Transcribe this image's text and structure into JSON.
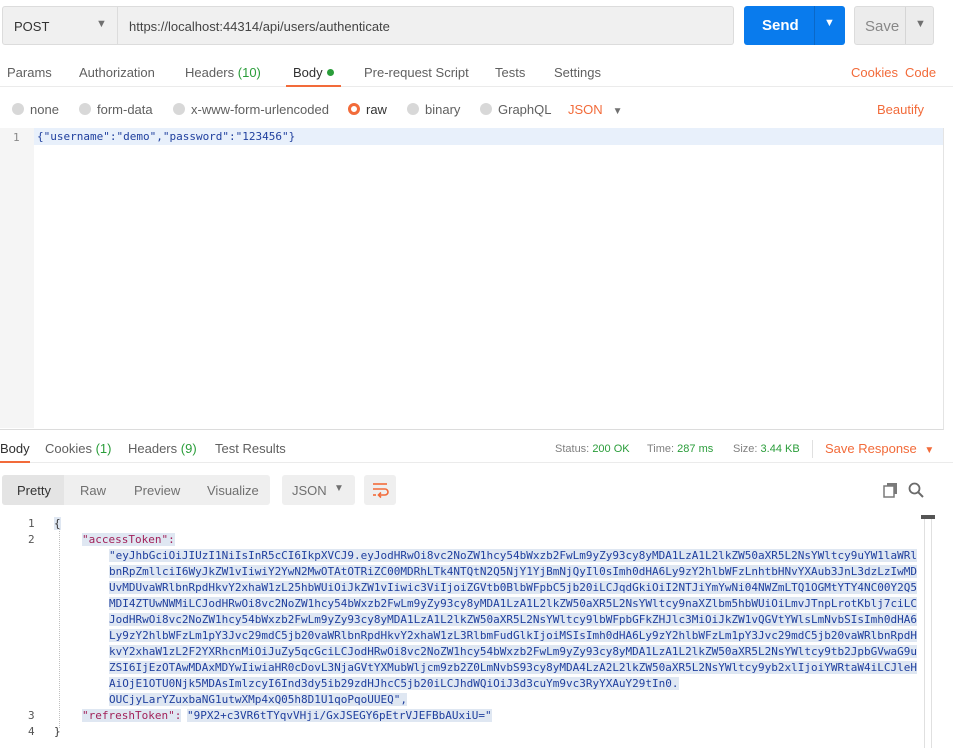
{
  "request": {
    "method": "POST",
    "url": "https://localhost:44314/api/users/authenticate",
    "send_label": "Send",
    "save_label": "Save"
  },
  "request_tabs": {
    "params": "Params",
    "authorization": "Authorization",
    "headers": "Headers",
    "headers_count": "(10)",
    "body": "Body",
    "prerequest": "Pre-request Script",
    "tests": "Tests",
    "settings": "Settings",
    "cookies": "Cookies",
    "code": "Code"
  },
  "body_modes": {
    "none": "none",
    "form_data": "form-data",
    "urlencoded": "x-www-form-urlencoded",
    "raw": "raw",
    "binary": "binary",
    "graphql": "GraphQL",
    "format": "JSON",
    "beautify": "Beautify"
  },
  "editor": {
    "line_number": "1",
    "content": "{\"username\":\"demo\",\"password\":\"123456\"}"
  },
  "response_tabs": {
    "body": "Body",
    "cookies": "Cookies",
    "cookies_count": "(1)",
    "headers": "Headers",
    "headers_count": "(9)",
    "test_results": "Test Results"
  },
  "response_meta": {
    "status_label": "Status:",
    "status_value": "200 OK",
    "time_label": "Time:",
    "time_value": "287 ms",
    "size_label": "Size:",
    "size_value": "3.44 KB",
    "save_response": "Save Response"
  },
  "response_toolbar": {
    "pretty": "Pretty",
    "raw": "Raw",
    "preview": "Preview",
    "visualize": "Visualize",
    "format": "JSON"
  },
  "response_body": {
    "line_numbers": [
      "1",
      "2",
      "3",
      "4"
    ],
    "open_brace": "{",
    "close_brace": "}",
    "access_key": "\"accessToken\":",
    "access_token_lines": [
      "\"eyJhbGciOiJIUzI1NiIsInR5cCI6IkpXVCJ9.eyJodHRwOi8vc2NoZW1hcy54bWxzb2FwLm9yZy93cy8yMDA1LzA1L2lkZW50aXR5L2NsYWltcy9uYW1laWRl",
      "bnRpZmllciI6WyJkZW1vIiwiY2YwN2MwOTAtOTRiZC00MDRhLTk4NTQtN2Q5NjY1YjBmNjQyIl0sImh0dHA6Ly9zY2hlbWFzLnhtbHNvYXAub3JnL3dzLzIwMD",
      "UvMDUvaWRlbnRpdHkvY2xhaW1zL25hbWUiOiJkZW1vIiwic3ViIjoiZGVtb0BlbWFpbC5jb20iLCJqdGkiOiI2NTJiYmYwNi04NWZmLTQ1OGMtYTY4NC00Y2Q5",
      "MDI4ZTUwNWMiLCJodHRwOi8vc2NoZW1hcy54bWxzb2FwLm9yZy93cy8yMDA1LzA1L2lkZW50aXR5L2NsYWltcy9naXZlbm5hbWUiOiLmvJTnpLrotKblj7ciLC",
      "JodHRwOi8vc2NoZW1hcy54bWxzb2FwLm9yZy93cy8yMDA1LzA1L2lkZW50aXR5L2NsYWltcy9lbWFpbGFkZHJlc3MiOiJkZW1vQGVtYWlsLmNvbSIsImh0dHA6",
      "Ly9zY2hlbWFzLm1pY3Jvc29mdC5jb20vaWRlbnRpdHkvY2xhaW1zL3RlbmFudGlkIjoiMSIsImh0dHA6Ly9zY2hlbWFzLm1pY3Jvc29mdC5jb20vaWRlbnRpdH",
      "kvY2xhaW1zL2F2YXRhcnMiOiJuZy5qcGciLCJodHRwOi8vc2NoZW1hcy54bWxzb2FwLm9yZy93cy8yMDA1LzA1L2lkZW50aXR5L2NsYWltcy9tb2JpbGVwaG9u",
      "ZSI6IjEzOTAwMDAxMDYwIiwiaHR0cDovL3NjaGVtYXMubWljcm9zb2Z0LmNvbS93cy8yMDA4LzA2L2lkZW50aXR5L2NsYWltcy9yb2xlIjoiYWRtaW4iLCJleH",
      "AiOjE1OTU0Njk5MDAsImlzcyI6Ind3dy5ib29zdHJhcC5jb20iLCJhdWQiOiJ3d3cuYm9vc3RyYXAuY29tIn0.",
      "OUCjyLarYZuxbaNG1utwXMp4xQ05h8D1U1qoPqoUUEQ\","
    ],
    "refresh_key": "\"refreshToken\":",
    "refresh_value": "\"9PX2+c3VR6tTYqvVHji/GxJSEGY6pEtrVJEFBbAUxiU=\""
  }
}
